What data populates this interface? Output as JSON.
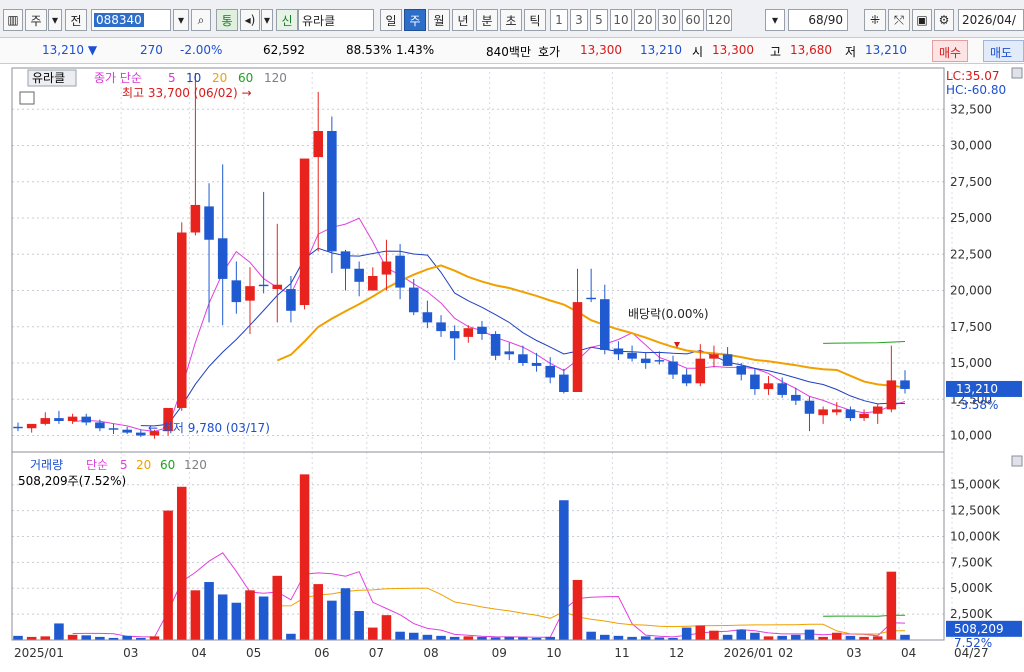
{
  "toolbar": {
    "tabs": [
      "주",
      "전"
    ],
    "code": "088340",
    "market_badge": "통",
    "credit_badge": "신",
    "stock_name": "유라클",
    "periods": [
      "일",
      "주",
      "월",
      "년",
      "분",
      "초",
      "틱"
    ],
    "active_period": "주",
    "intervals": [
      "1",
      "3",
      "5",
      "10",
      "20",
      "30",
      "60",
      "120"
    ],
    "page_counter": "68/90",
    "date": "2026/04/"
  },
  "quote": {
    "price": "13,210",
    "change": "270",
    "change_pct": "-2.00%",
    "volume": "62,592",
    "ratio": "88.53%",
    "turnover": "1.43%",
    "amount": "840백만",
    "ask_label": "호가",
    "ask": "13,300",
    "bid": "13,210",
    "open_label": "시",
    "open": "13,300",
    "high_label": "고",
    "high": "13,680",
    "low_label": "저",
    "low": "13,210",
    "buy": "매수",
    "sell": "매도"
  },
  "price_panel": {
    "name": "유라클",
    "ma_label": "종가 단순",
    "ma_periods": [
      "5",
      "10",
      "20",
      "60",
      "120"
    ],
    "ma_colors": [
      "#d63ad6",
      "#2040c0",
      "#f0a000",
      "#20a020",
      "#808080"
    ],
    "lc": "LC:35.07",
    "hc": "HC:-60.80",
    "high_annot": "최고 33,700 (06/02)",
    "low_annot": "최저 9,780 (03/17)",
    "dividend_annot": "배당락(0.00%)",
    "current_price": "13,210",
    "current_pct": "-3.58%",
    "y_ticks": [
      "32,500",
      "30,000",
      "27,500",
      "25,000",
      "22,500",
      "20,000",
      "17,500",
      "15,000",
      "12,500",
      "10,000"
    ]
  },
  "volume_panel": {
    "label": "거래량",
    "ma_label": "단순",
    "ma_periods": [
      "5",
      "20",
      "60",
      "120"
    ],
    "info": "508,209주(7.52%)",
    "current": "508,209",
    "current_pct": "7.52%",
    "y_ticks": [
      "15,000K",
      "12,500K",
      "10,000K",
      "7,500K",
      "5,000K",
      "2,500K"
    ]
  },
  "x_labels": [
    "2025/01",
    "03",
    "04",
    "05",
    "06",
    "07",
    "08",
    "09",
    "10",
    "11",
    "12",
    "2026/01",
    "02",
    "03",
    "04",
    "04/27"
  ],
  "colors": {
    "up": "#e8231e",
    "down": "#1f5ad0",
    "ma5": "#e040e0",
    "ma10": "#2040c0",
    "ma20": "#f0a000",
    "ma60": "#20a020"
  },
  "chart_data": {
    "type": "candlestick",
    "candles": [
      [
        10600,
        10900,
        10300,
        10500
      ],
      [
        10500,
        10700,
        10200,
        10800
      ],
      [
        10800,
        11600,
        10700,
        11200
      ],
      [
        11200,
        11700,
        10800,
        11000
      ],
      [
        11000,
        11500,
        10800,
        11300
      ],
      [
        11300,
        11500,
        10700,
        10900
      ],
      [
        10900,
        11100,
        10300,
        10500
      ],
      [
        10500,
        10800,
        10100,
        10400
      ],
      [
        10400,
        10600,
        10100,
        10200
      ],
      [
        10200,
        10400,
        9900,
        10000
      ],
      [
        10000,
        10400,
        9780,
        10300
      ],
      [
        10300,
        11900,
        10000,
        11900
      ],
      [
        11900,
        24700,
        11700,
        24000
      ],
      [
        24000,
        35000,
        23800,
        25900
      ],
      [
        25800,
        27400,
        17800,
        23500
      ],
      [
        23600,
        28700,
        17600,
        20800
      ],
      [
        20700,
        22000,
        18400,
        19200
      ],
      [
        19300,
        21600,
        17000,
        20300
      ],
      [
        20400,
        26800,
        19800,
        20300
      ],
      [
        20100,
        24600,
        17800,
        20400
      ],
      [
        20100,
        21000,
        17800,
        18600
      ],
      [
        19000,
        24900,
        18700,
        29100
      ],
      [
        29200,
        33700,
        22700,
        31000
      ],
      [
        31000,
        32000,
        21200,
        22700
      ],
      [
        22700,
        22800,
        20000,
        21500
      ],
      [
        21500,
        22000,
        19600,
        20600
      ],
      [
        20000,
        21600,
        20200,
        21000
      ],
      [
        21100,
        23500,
        20000,
        22000
      ],
      [
        22400,
        23200,
        19400,
        20200
      ],
      [
        20200,
        20800,
        18300,
        18500
      ],
      [
        18500,
        19300,
        17400,
        17800
      ],
      [
        17800,
        18300,
        16800,
        17200
      ],
      [
        17200,
        17600,
        15200,
        16700
      ],
      [
        16800,
        17600,
        16400,
        17400
      ],
      [
        17500,
        17900,
        16600,
        17000
      ],
      [
        17000,
        17200,
        15200,
        15500
      ],
      [
        15800,
        16400,
        15200,
        15600
      ],
      [
        15600,
        16200,
        14800,
        15000
      ],
      [
        15000,
        15700,
        14400,
        14800
      ],
      [
        14800,
        15400,
        13600,
        14000
      ],
      [
        14200,
        14600,
        12900,
        13000
      ],
      [
        13000,
        21500,
        13000,
        19200
      ],
      [
        19500,
        21500,
        19200,
        19400
      ],
      [
        19400,
        20400,
        15600,
        15900
      ],
      [
        16000,
        16500,
        15200,
        15600
      ],
      [
        15700,
        16200,
        15100,
        15300
      ],
      [
        15300,
        15700,
        14600,
        15000
      ],
      [
        15200,
        15800,
        14900,
        15100
      ],
      [
        15100,
        15500,
        13900,
        14200
      ],
      [
        14200,
        14600,
        13400,
        13600
      ],
      [
        13600,
        16300,
        13400,
        15300
      ],
      [
        15300,
        16200,
        14700,
        15600
      ],
      [
        15600,
        16100,
        14800,
        14800
      ],
      [
        14800,
        15000,
        13800,
        14200
      ],
      [
        14200,
        14600,
        12800,
        13200
      ],
      [
        13200,
        14100,
        12800,
        13600
      ],
      [
        13600,
        14000,
        12600,
        12800
      ],
      [
        12800,
        13300,
        12100,
        12400
      ],
      [
        12400,
        12700,
        10300,
        11500
      ],
      [
        11400,
        12000,
        10800,
        11800
      ],
      [
        11600,
        12300,
        11400,
        11800
      ],
      [
        11800,
        12000,
        11000,
        11200
      ],
      [
        11200,
        11800,
        11000,
        11500
      ],
      [
        11500,
        12200,
        10800,
        12000
      ],
      [
        11800,
        16200,
        11600,
        13800
      ],
      [
        13800,
        14500,
        12900,
        13210
      ]
    ],
    "volume": [
      400,
      300,
      350,
      1600,
      500,
      450,
      300,
      200,
      400,
      200,
      350,
      12500,
      14800,
      4800,
      5600,
      4400,
      3600,
      4800,
      4200,
      6200,
      600,
      16000,
      5400,
      3800,
      5000,
      2800,
      1200,
      2400,
      800,
      700,
      500,
      400,
      300,
      350,
      300,
      250,
      300,
      250,
      200,
      300,
      13500,
      5800,
      800,
      500,
      400,
      300,
      350,
      250,
      200,
      1200,
      1400,
      900,
      500,
      1000,
      700,
      350,
      400,
      500,
      1000,
      300,
      700,
      400,
      300,
      350,
      6600,
      500
    ]
  }
}
